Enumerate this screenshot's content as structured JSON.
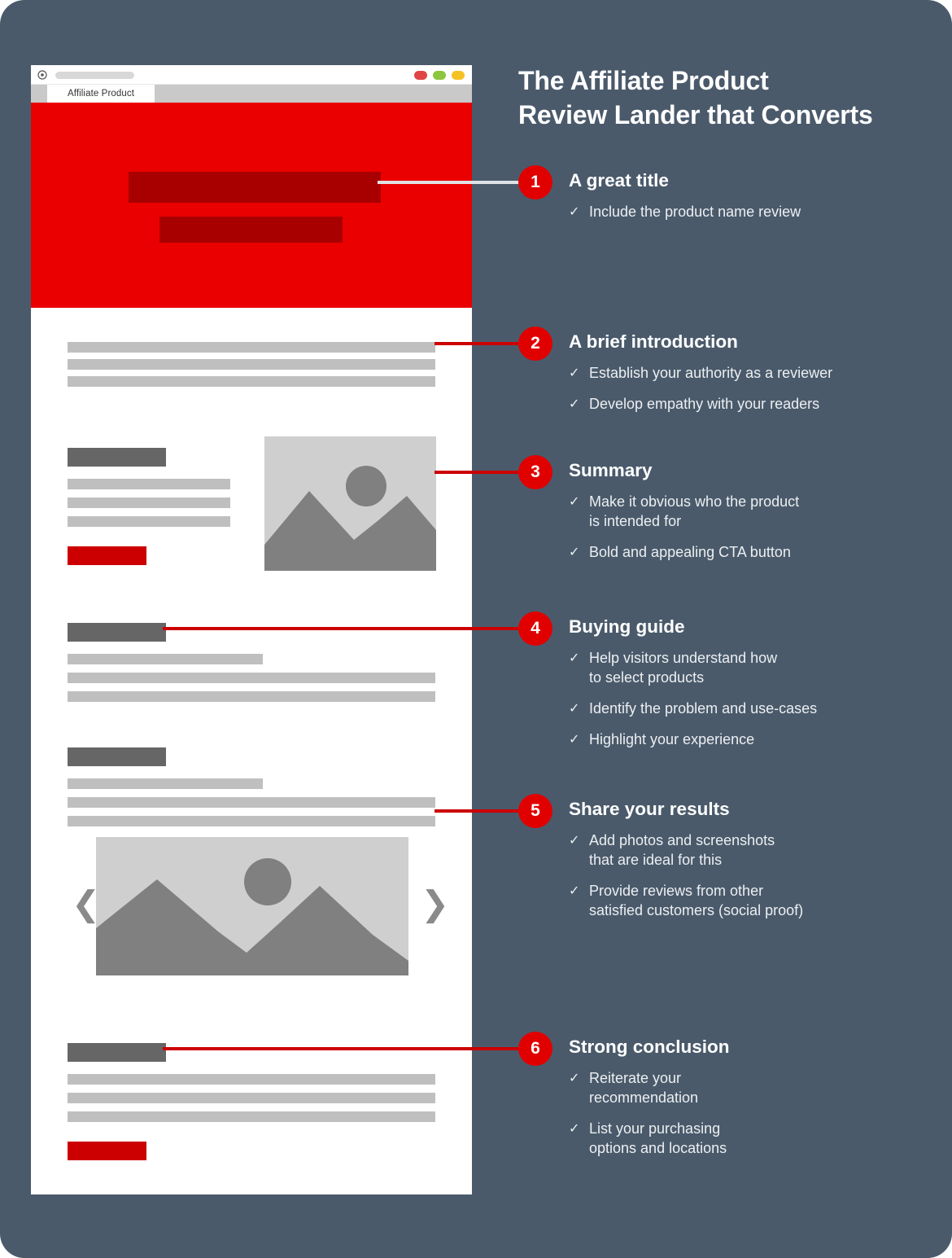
{
  "theme": {
    "background": "#4a5a6b",
    "accent_red": "#e10000",
    "hero_red": "#ea0000",
    "cta_red": "#cc0000",
    "text_light": "#eceff1"
  },
  "headline": {
    "line1": "The Affiliate Product",
    "line2": "Review Lander that Converts"
  },
  "browser": {
    "tab_label": "Affiliate Product",
    "icons": {
      "target": "target-icon",
      "url_pill": "url-pill"
    },
    "window_dots": [
      {
        "name": "close-dot",
        "color": "#e04545"
      },
      {
        "name": "minimize-dot",
        "color": "#8cc63f"
      },
      {
        "name": "maximize-dot",
        "color": "#f5c226"
      }
    ]
  },
  "steps": [
    {
      "number": "1",
      "title": "A great title",
      "bullets": [
        "Include the product name review"
      ]
    },
    {
      "number": "2",
      "title": "A brief introduction",
      "bullets": [
        "Establish your authority as a reviewer",
        "Develop empathy with your readers"
      ]
    },
    {
      "number": "3",
      "title": "Summary",
      "bullets": [
        "Make it obvious who the product\nis intended for",
        "Bold and appealing CTA button"
      ]
    },
    {
      "number": "4",
      "title": "Buying guide",
      "bullets": [
        "Help visitors understand how\nto select products",
        "Identify the problem and use-cases",
        "Highlight your experience"
      ]
    },
    {
      "number": "5",
      "title": "Share your results",
      "bullets": [
        "Add photos and screenshots\nthat are ideal for this",
        "Provide reviews from other\nsatisfied customers (social proof)"
      ]
    },
    {
      "number": "6",
      "title": "Strong conclusion",
      "bullets": [
        "Reiterate your\nrecommendation",
        "List your purchasing\noptions and locations"
      ]
    }
  ],
  "icons": {
    "check": "✓",
    "carousel_prev": "❮",
    "carousel_next": "❯"
  }
}
